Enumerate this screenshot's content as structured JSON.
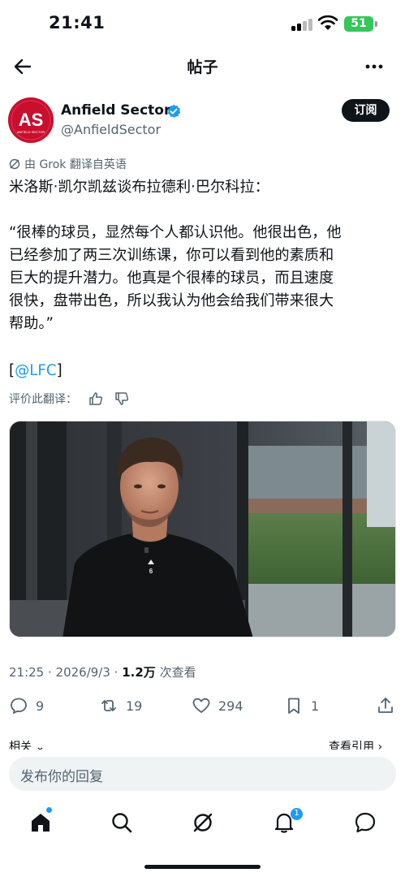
{
  "status_bar": {
    "time": "21:41",
    "battery": "51"
  },
  "header": {
    "title": "帖子"
  },
  "author": {
    "name": "Anfield Sector",
    "handle": "@AnfieldSector",
    "avatar_text": "AS",
    "avatar_subtext": "ANFIELD SECTOR",
    "follow_label": "订阅"
  },
  "post": {
    "translate_note": "由 Grok 翻译自英语",
    "lines": [
      "米洛斯·凯尔凯兹谈布拉德利·巴尔科拉：",
      "",
      "“很棒的球员，显然每个人都认识他。他很出色，他",
      "已经参加了两三次训练课，你可以看到他的素质和",
      "巨大的提升潜力。他真是个很棒的球员，而且速度",
      "很快，盘带出色，所以我认为他会给我们带来很大",
      "帮助。”"
    ],
    "mention_open": "[",
    "mention": "@LFC",
    "mention_close": "]",
    "rate_label": "评价此翻译：",
    "jersey_number": "6"
  },
  "meta": {
    "time_date": "21:25 · 2026/9/3 · ",
    "views": "1.2万",
    "views_label": " 次查看"
  },
  "actions": {
    "replies": "9",
    "reposts": "19",
    "likes": "294",
    "bookmarks": "1"
  },
  "related": {
    "left": "相关 ⌄",
    "right": "查看引用 ›"
  },
  "reply": {
    "placeholder": "发布你的回复"
  },
  "nav": {
    "notification_count": "1"
  },
  "colors": {
    "accent": "#1d9bf0",
    "text": "#0f1419",
    "muted": "#536471",
    "brand_red": "#c8102e"
  }
}
